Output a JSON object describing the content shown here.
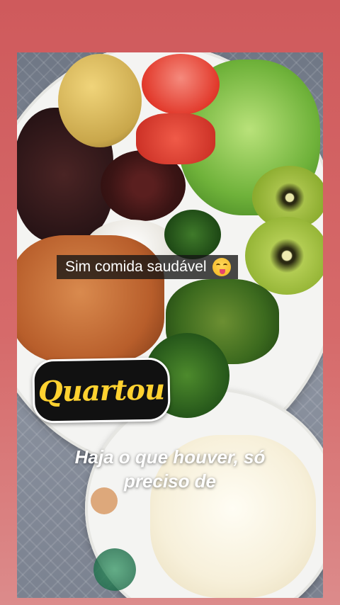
{
  "story": {
    "caption_text": "Sim comida saudável",
    "caption_emoji": "face-savoring-food-emoji",
    "sticker_text": "Quartou",
    "overlay_text": "Haja o que houver, só preciso de",
    "colors": {
      "background_top": "#cf5a5c",
      "background_bottom": "#dc8b8b",
      "sticker_text": "#ffd230",
      "sticker_bg": "#111111",
      "caption_bg": "#141414"
    }
  }
}
